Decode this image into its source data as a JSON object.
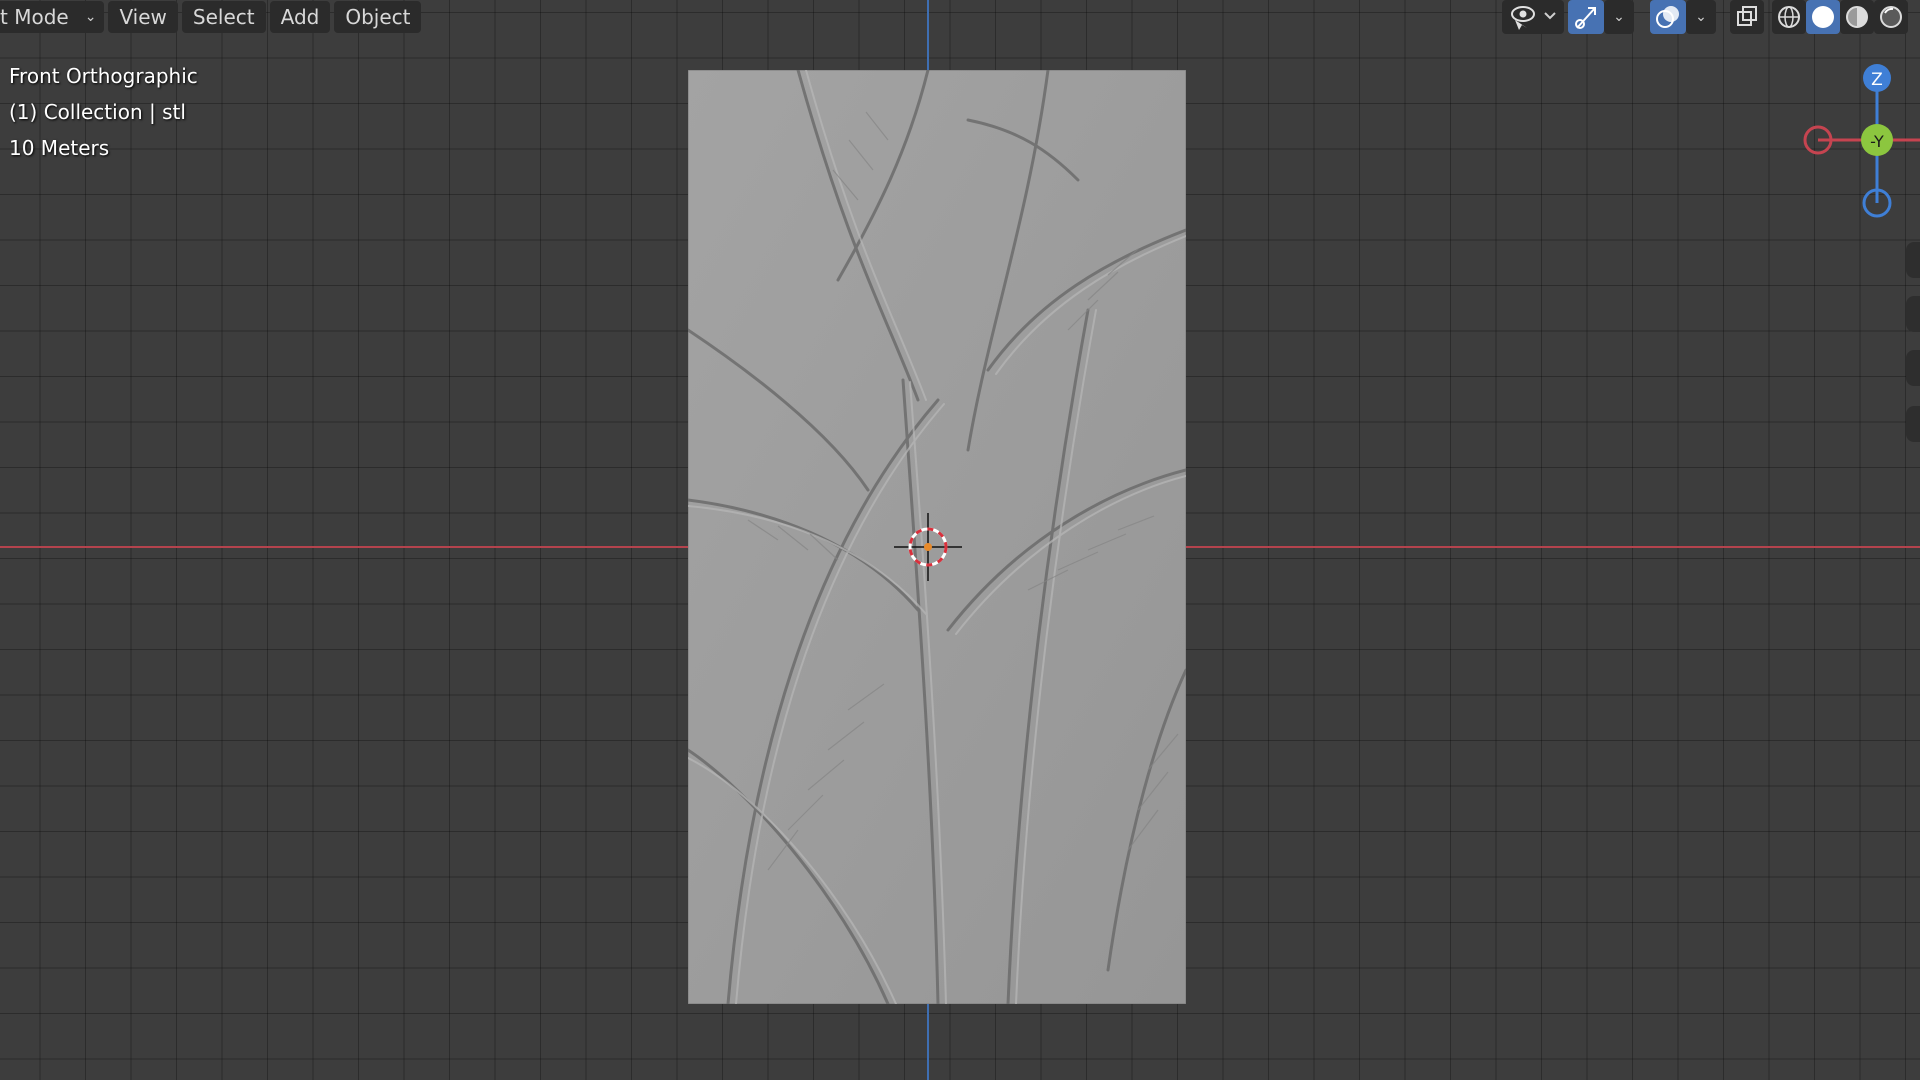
{
  "header": {
    "mode_label": "t Mode",
    "menu": {
      "view": "View",
      "select": "Select",
      "add": "Add",
      "object": "Object"
    }
  },
  "overlay": {
    "view_name": "Front Orthographic",
    "collection": "(1) Collection | stl",
    "scale": "10 Meters"
  },
  "gizmo": {
    "z_label": "Z",
    "y_label": "-Y"
  },
  "colors": {
    "background": "#3d3d3d",
    "x_axis": "#b4434d",
    "z_axis": "#3f6fb2",
    "gizmo_x": "#c64450",
    "gizmo_y": "#8cc63f",
    "gizmo_z": "#3f7fd6",
    "toolbar_active": "#4772b3",
    "panel": "#9a9a9a"
  },
  "icons": [
    "visibility-eye-icon",
    "gizmo-icon",
    "overlay-icon",
    "xray-icon",
    "wireframe-shading-icon",
    "solid-shading-icon",
    "material-shading-icon",
    "rendered-shading-icon",
    "3d-cursor-icon"
  ]
}
